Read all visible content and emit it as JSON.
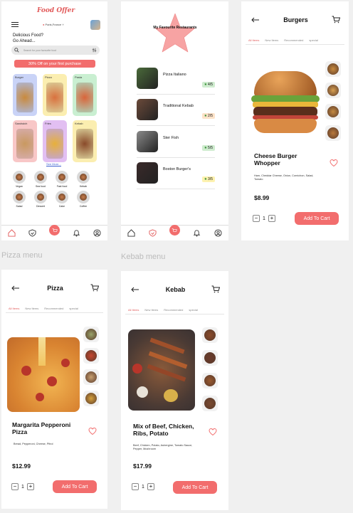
{
  "colors": {
    "accent": "#f26d6d",
    "brand": "#e25a5a",
    "link": "#3a5fd0",
    "rating_green": "#cfeccf",
    "rating_orange": "#fde3c9",
    "rating_yellow": "#fdf2b0",
    "star": "#f7a3a3"
  },
  "section_labels": {
    "pizza": "Pizza menu",
    "kebab": "Kebab menu"
  },
  "home": {
    "logo": "Food Offer",
    "location": "Paris,France",
    "greeting_line1": "Delicious Food?",
    "greeting_line2": "Go Ahead...",
    "search_placeholder": "Search for your favourite food",
    "banner": "30% Off on your first purchase",
    "categories": [
      {
        "label": "Burger",
        "bg": "#c9d3f7",
        "food": "#c98a3d"
      },
      {
        "label": "Pizza",
        "bg": "#fbeeb0",
        "food": "#d9713e"
      },
      {
        "label": "Pasta",
        "bg": "#c9efd1",
        "food": "#d9653a"
      },
      {
        "label": "Sandwich",
        "bg": "#f8c7c7",
        "food": "#c99960"
      },
      {
        "label": "Fries",
        "bg": "#e2bff2",
        "food": "#e7b03a"
      },
      {
        "label": "Kebab",
        "bg": "#fbeeb0",
        "food": "#8a4a2a"
      }
    ],
    "see_more": "See More...",
    "subcategories": [
      "Vegan",
      "Sea food",
      "Fast food",
      "Kebab",
      "Salad",
      "Dessert",
      "Cake",
      "Coffee"
    ],
    "nav": [
      "home-icon",
      "shield-icon",
      "cart-icon",
      "bell-icon",
      "user-icon"
    ]
  },
  "restaurants": {
    "badge": "My Favourite Restaurants",
    "items": [
      {
        "name": "Pizza Italiano",
        "rating": "4/5",
        "color": "#cfeccf",
        "img": "#4a6a3a"
      },
      {
        "name": "Traditional Kebab",
        "rating": "2/5",
        "color": "#fde3c9",
        "img": "#6b4a3a"
      },
      {
        "name": "Ster Fish",
        "rating": "5/5",
        "color": "#cfeccf",
        "img": "#8a8a8a"
      },
      {
        "name": "Boston Burger's",
        "rating": "3/5",
        "color": "#fdf2b0",
        "img": "#3a2a2a"
      }
    ]
  },
  "burgers": {
    "title": "Burgers",
    "tabs": [
      "All Items",
      "New Items",
      "Recommended",
      "special"
    ],
    "name": "Cheese Burger Whopper",
    "ingredients": "Ham, Cheddar Cheese, Onion, Cornichon, Salad, Tomato",
    "price": "$8.99",
    "qty": "1",
    "add_to_cart": "Add To Cart",
    "thumbs": [
      "#c98a3d",
      "#d9a050",
      "#c58a40",
      "#b8783a"
    ]
  },
  "pizza": {
    "title": "Pizza",
    "tabs": [
      "All Items",
      "New Items",
      "Recommended",
      "special"
    ],
    "name": "Margarita Pepperoni Pizza",
    "ingredients": "Bread, Pepperoni, Cheese, Pitrol",
    "price": "$12.99",
    "qty": "1",
    "add_to_cart": "Add To Cart",
    "thumbs": [
      "#9aa46a",
      "#c6452e",
      "#c8a070",
      "#d6a03a"
    ]
  },
  "kebab": {
    "title": "Kebab",
    "tabs": [
      "All Items",
      "New Items",
      "Recommended",
      "special"
    ],
    "name": "Mix of Beef, Chicken, Ribs, Potato",
    "ingredients": "Beef, Chicken, Potato, Aubergine, Tomato Sauce, Pepper, Mushroom",
    "price": "$17.99",
    "qty": "1",
    "add_to_cart": "Add To Cart",
    "thumbs": [
      "#8a4a2a",
      "#6a3a2a",
      "#9a5a30",
      "#7a4a30"
    ]
  }
}
